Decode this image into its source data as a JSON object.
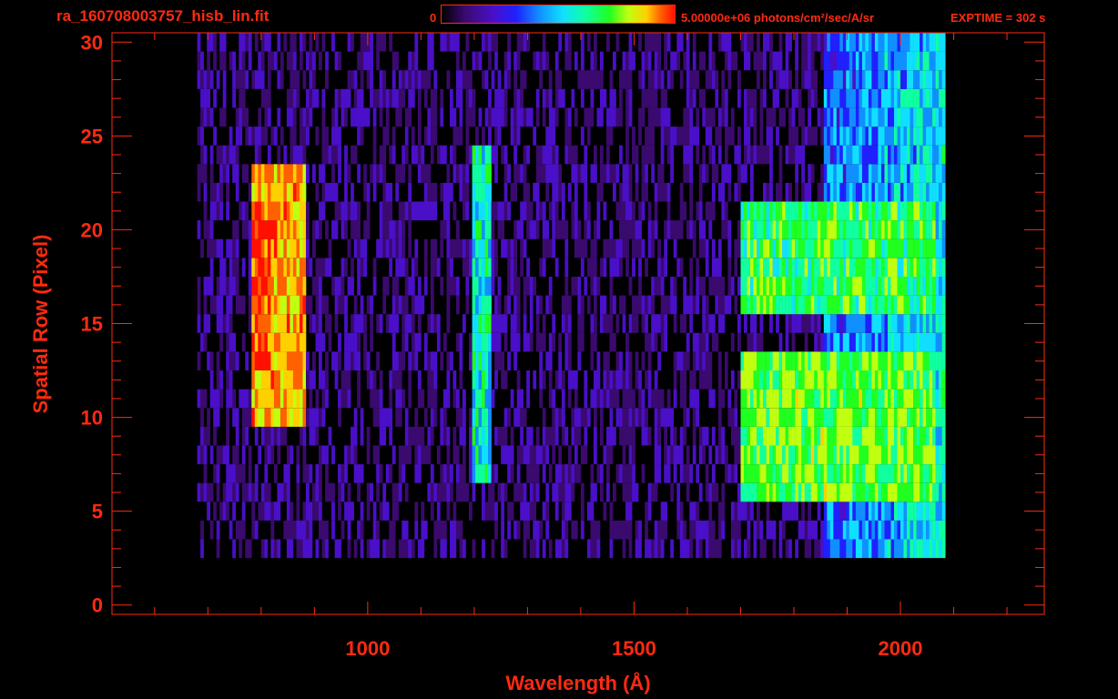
{
  "header": {
    "filename": "ra_160708003757_hisb_lin.fit",
    "colorbar_min": "0",
    "colorbar_max": "5.00000e+06 photons/cm²/sec/A/sr",
    "exptime": "EXPTIME = 302 s"
  },
  "colors": {
    "axis": "#ff2a10",
    "background": "#000000",
    "colormap": [
      "#000000",
      "#3a0a6e",
      "#4a0fc8",
      "#2020ff",
      "#1090ff",
      "#10e0ff",
      "#10ffa0",
      "#20ff20",
      "#c0ff10",
      "#ffd000",
      "#ff6000",
      "#ff1000"
    ]
  },
  "chart_data": {
    "type": "heatmap",
    "title": "ra_160708003757_hisb_lin.fit",
    "xlabel": "Wavelength (Å)",
    "ylabel": "Spatial Row (Pixel)",
    "xlim": [
      520,
      2270
    ],
    "ylim": [
      -0.5,
      30.5
    ],
    "x_ticks": [
      1000,
      1500,
      2000
    ],
    "y_ticks": [
      0,
      5,
      10,
      15,
      20,
      25,
      30
    ],
    "colorbar_range": [
      0,
      5000000
    ],
    "colorbar_units": "photons/cm²/sec/A/sr",
    "exposure_time_s": 302,
    "spectrum_extent_wavelength": [
      680,
      2080
    ],
    "features": [
      {
        "wavelength_range": [
          780,
          880
        ],
        "rows": [
          10,
          23
        ],
        "peak_rows": [
          13,
          21
        ],
        "level": 0.85
      },
      {
        "wavelength_range": [
          1195,
          1230
        ],
        "rows": [
          7,
          24
        ],
        "level": 0.5
      },
      {
        "wavelength_range": [
          1700,
          2065
        ],
        "rows": [
          16,
          21
        ],
        "level": 0.6
      },
      {
        "wavelength_range": [
          1700,
          2065
        ],
        "rows": [
          6,
          13
        ],
        "level": 0.65
      }
    ]
  }
}
